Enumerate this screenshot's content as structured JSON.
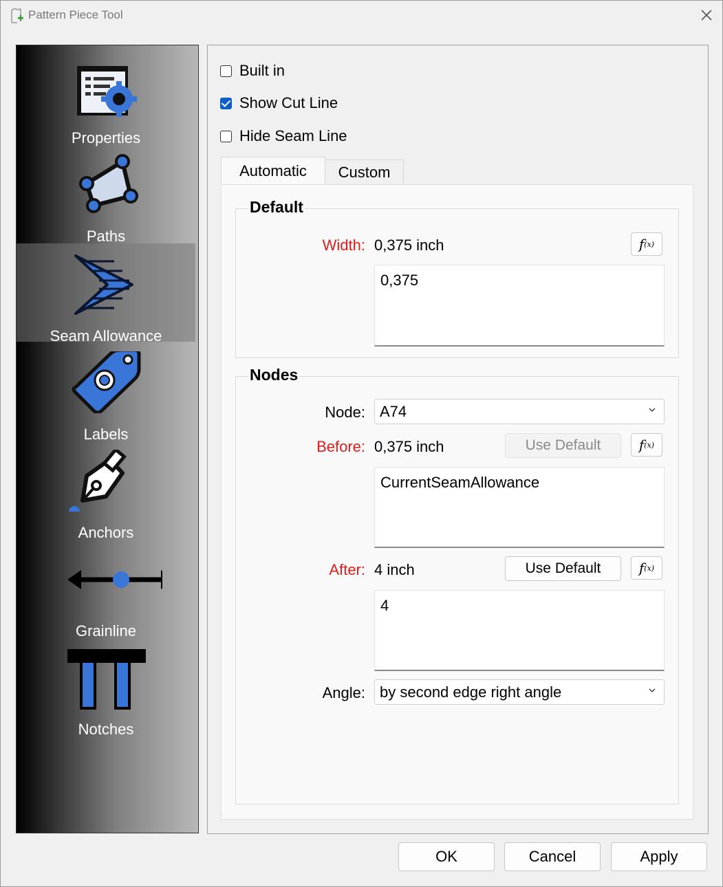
{
  "window": {
    "title": "Pattern Piece Tool"
  },
  "sidebar": {
    "items": [
      {
        "label": "Properties",
        "icon": "properties-icon"
      },
      {
        "label": "Paths",
        "icon": "paths-icon"
      },
      {
        "label": "Seam Allowance",
        "icon": "seam-allowance-icon",
        "active": true
      },
      {
        "label": "Labels",
        "icon": "labels-icon"
      },
      {
        "label": "Anchors",
        "icon": "anchors-icon"
      },
      {
        "label": "Grainline",
        "icon": "grainline-icon"
      },
      {
        "label": "Notches",
        "icon": "notches-icon"
      }
    ]
  },
  "options": {
    "built_in": {
      "label": "Built in",
      "checked": false
    },
    "show_cut_line": {
      "label": "Show Cut Line",
      "checked": true
    },
    "hide_seam_line": {
      "label": "Hide Seam Line",
      "checked": false
    }
  },
  "tabs": {
    "automatic": "Automatic",
    "custom": "Custom"
  },
  "default_group": {
    "title": "Default",
    "width_label": "Width:",
    "width_value": "0,375 inch",
    "width_formula": "0,375"
  },
  "nodes_group": {
    "title": "Nodes",
    "node_label": "Node:",
    "node_value": "A74",
    "before_label": "Before:",
    "before_value": "0,375 inch",
    "before_formula": "CurrentSeamAllowance",
    "after_label": "After:",
    "after_value": "4 inch",
    "after_formula": "4",
    "use_default_label": "Use Default",
    "angle_label": "Angle:",
    "angle_value": "by second edge right angle"
  },
  "fx_label": "f",
  "fx_sub": "(x)",
  "footer": {
    "ok": "OK",
    "cancel": "Cancel",
    "apply": "Apply"
  },
  "colors": {
    "accent_blue": "#3a76d8",
    "required_red": "#e21b1b",
    "checkbox_blue": "#0f5ec7"
  }
}
